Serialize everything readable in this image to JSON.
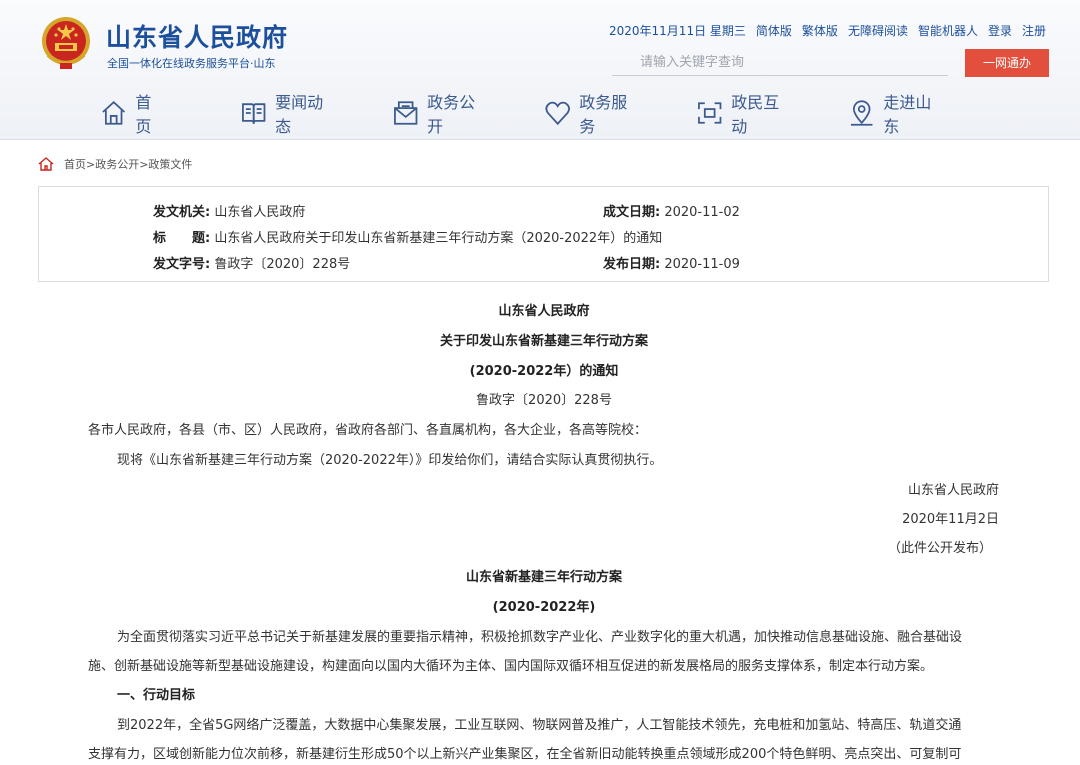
{
  "header": {
    "title": "山东省人民政府",
    "subtitle": "全国一体化在线政务服务平台·山东",
    "date": "2020年11月11日 星期三",
    "links": [
      "简体版",
      "繁体版",
      "无障碍阅读",
      "智能机器人",
      "登录",
      "注册"
    ],
    "search_placeholder": "请输入关键字查询",
    "search_button": "一网通办"
  },
  "nav": [
    {
      "label": "首 页",
      "icon": "home-icon"
    },
    {
      "label": "要闻动态",
      "icon": "book-icon"
    },
    {
      "label": "政务公开",
      "icon": "mail-icon"
    },
    {
      "label": "政务服务",
      "icon": "heart-icon"
    },
    {
      "label": "政民互动",
      "icon": "interact-icon"
    },
    {
      "label": "走进山东",
      "icon": "location-icon"
    }
  ],
  "breadcrumb": "首页>政务公开>政策文件",
  "meta": {
    "issuer_label": "发文机关:",
    "issuer": "山东省人民政府",
    "date_label": "成文日期:",
    "date": "2020-11-02",
    "title_label": "标　　题:",
    "title": "山东省人民政府关于印发山东省新基建三年行动方案（2020-2022年）的通知",
    "doc_no_label": "发文字号:",
    "doc_no": "鲁政字〔2020〕228号",
    "pub_label": "发布日期:",
    "pub_date": "2020-11-09"
  },
  "document": {
    "heading1": "山东省人民政府",
    "heading2": "关于印发山东省新基建三年行动方案",
    "heading3": "(2020-2022年）的通知",
    "doc_no": "鲁政字〔2020〕228号",
    "recipients": "各市人民政府，各县（市、区）人民政府，省政府各部门、各直属机构，各大企业，各高等院校：",
    "notice": "现将《山东省新基建三年行动方案（2020-2022年）》印发给你们，请结合实际认真贯彻执行。",
    "sign_org": "山东省人民政府",
    "sign_date": "2020年11月2日",
    "publish_note": "（此件公开发布）",
    "plan_title": "山东省新基建三年行动方案",
    "plan_years": "(2020-2022年)",
    "para1_a": "为全面贯彻落实习近平总书记关于新基建发展的重要指示精神，积极抢抓数字产业化、产业数字化的重大机遇，加快推动信息基础设施、融合基础设",
    "para1_b": "施、创新基础设施等新型基础设施建设，构建面向以国内大循环为主体、国内国际双循环相互促进的新发展格局的服务支撑体系，制定本行动方案。",
    "section1": "一、行动目标",
    "para2_a": "到2022年，全省5G网络广泛覆盖，大数据中心集聚发展，工业互联网、物联网普及推广，人工智能技术领先，充电桩和加氢站、特高压、轨道交通",
    "para2_b": "支撑有力，区域创新能力位次前移，新基建衍生形成50个以上新兴产业集聚区，在全省新旧动能转换重点领域形成200个特色鲜明、亮点突出、可复制可"
  }
}
